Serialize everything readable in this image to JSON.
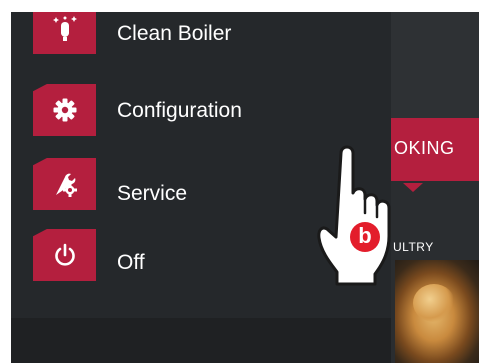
{
  "menu": {
    "items": [
      {
        "label": "Clean Boiler",
        "icon": "boiler-clean-icon"
      },
      {
        "label": "Configuration",
        "icon": "gear-icon"
      },
      {
        "label": "Service",
        "icon": "wrench-gear-icon"
      },
      {
        "label": "Off",
        "icon": "power-icon"
      }
    ]
  },
  "background_app": {
    "mode_banner": "OKING",
    "subtab": "ULTRY"
  },
  "pointer": {
    "badge_letter": "b"
  },
  "colors": {
    "accent": "#b41f3e",
    "menu_bg": "#25282b",
    "text": "#ffffff"
  }
}
